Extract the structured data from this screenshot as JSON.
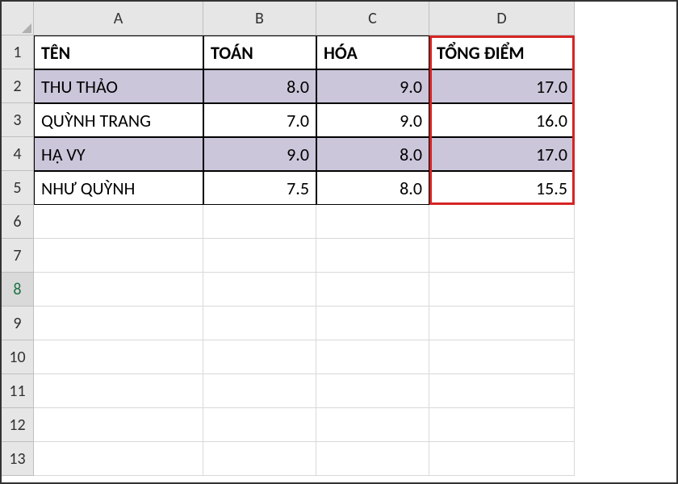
{
  "columns": [
    "A",
    "B",
    "C",
    "D"
  ],
  "rows": [
    "1",
    "2",
    "3",
    "4",
    "5",
    "6",
    "7",
    "8",
    "9",
    "10",
    "11",
    "12",
    "13"
  ],
  "activeRow": "8",
  "headers": {
    "A": "TÊN",
    "B": "TOÁN",
    "C": "HÓA",
    "D": "TỔNG ĐIỂM"
  },
  "data": [
    {
      "name": "THU THẢO",
      "toan": "8.0",
      "hoa": "9.0",
      "tong": "17.0",
      "shaded": true
    },
    {
      "name": "QUỲNH TRANG",
      "toan": "7.0",
      "hoa": "9.0",
      "tong": "16.0",
      "shaded": false
    },
    {
      "name": "HẠ VY",
      "toan": "9.0",
      "hoa": "8.0",
      "tong": "17.0",
      "shaded": true
    },
    {
      "name": "NHƯ QUỲNH",
      "toan": "7.5",
      "hoa": "8.0",
      "tong": "15.5",
      "shaded": false
    }
  ],
  "highlight": {
    "col": "D",
    "rowStart": 1,
    "rowEnd": 5
  },
  "chart_data": {
    "type": "table",
    "columns": [
      "TÊN",
      "TOÁN",
      "HÓA",
      "TỔNG ĐIỂM"
    ],
    "rows": [
      [
        "THU THẢO",
        8.0,
        9.0,
        17.0
      ],
      [
        "QUỲNH TRANG",
        7.0,
        9.0,
        16.0
      ],
      [
        "HẠ VY",
        9.0,
        8.0,
        17.0
      ],
      [
        "NHƯ QUỲNH",
        7.5,
        8.0,
        15.5
      ]
    ]
  }
}
